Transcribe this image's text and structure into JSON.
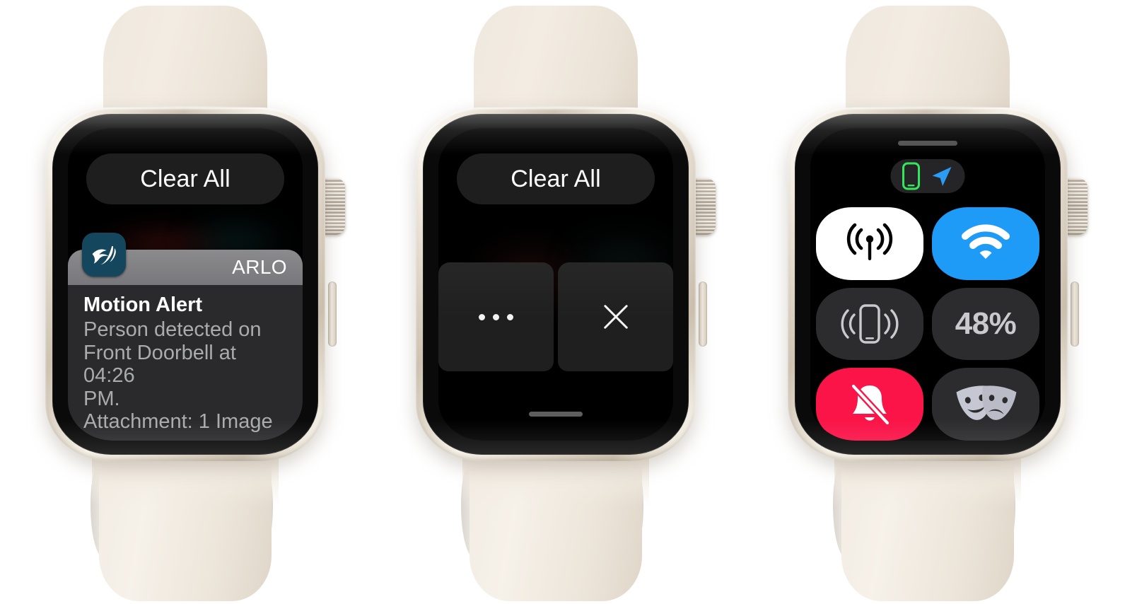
{
  "scene": {
    "device": "apple-watch",
    "band_color": "#efe8de",
    "case_color": "#e2d9cc",
    "screen_bg": "#000000",
    "watch_count": 3
  },
  "watch1": {
    "label": "notification-list",
    "clear_all_label": "Clear All",
    "notification": {
      "app_name": "ARLO",
      "app_icon": "arlo-bird-icon",
      "app_icon_bg": "#14465e",
      "title": "Motion Alert",
      "body": "Person detected on\nFront Doorbell at 04:26\nPM.\nAttachment: 1 Image",
      "header_bg": "#7d7d81",
      "card_bg": "#2a2a2c"
    }
  },
  "watch2": {
    "label": "notification-swipe-actions",
    "clear_all_label": "Clear All",
    "actions": [
      {
        "name": "more-options",
        "icon": "ellipsis-icon",
        "label": "•••"
      },
      {
        "name": "dismiss",
        "icon": "close-x-icon",
        "label": "×"
      }
    ]
  },
  "watch3": {
    "label": "control-center",
    "status_icons": [
      {
        "name": "iphone-connected-icon",
        "color": "#35e65c"
      },
      {
        "name": "location-arrow-icon",
        "color": "#2b9bf4"
      }
    ],
    "tiles": [
      {
        "name": "cellular-toggle",
        "icon": "cellular-antenna-icon",
        "bg": "#ffffff",
        "fg": "#000000",
        "text": ""
      },
      {
        "name": "wifi-toggle",
        "icon": "wifi-icon",
        "bg": "#1d9bf6",
        "fg": "#ffffff",
        "text": ""
      },
      {
        "name": "ping-iphone",
        "icon": "ping-iphone-icon",
        "bg": "#2c2c2e",
        "fg": "#c9c9ce",
        "text": ""
      },
      {
        "name": "battery-percent",
        "icon": "",
        "bg": "#2c2c2e",
        "fg": "#c9c9ce",
        "text": "48%"
      },
      {
        "name": "silent-mode-toggle",
        "icon": "bell-slash-icon",
        "bg": "#fa1448",
        "fg": "#ffffff",
        "text": ""
      },
      {
        "name": "theater-mode",
        "icon": "theater-masks-icon",
        "bg": "#2c2c2e",
        "fg": "#c5c8d2",
        "text": ""
      }
    ],
    "battery_value": "48%"
  }
}
